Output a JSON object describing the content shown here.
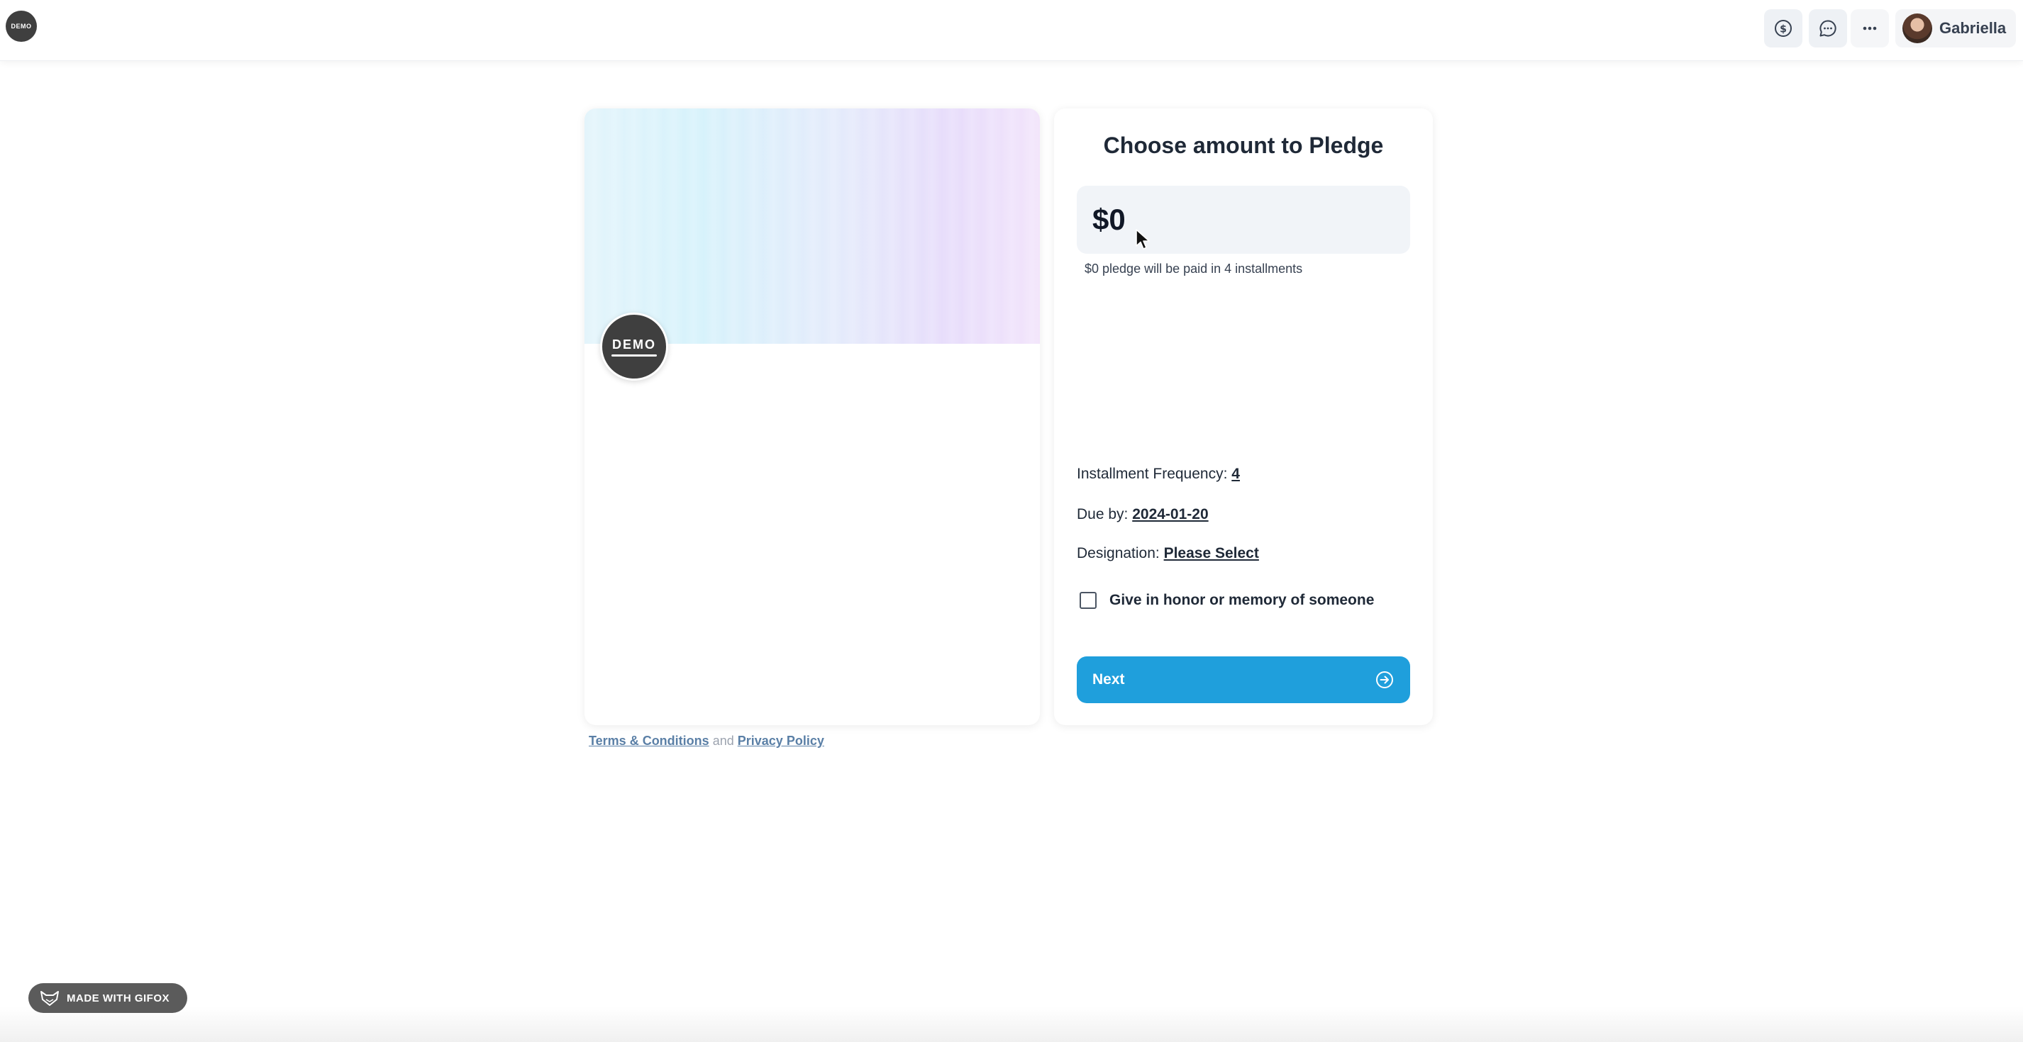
{
  "topbar": {
    "logo_text": "DEMO",
    "user_name": "Gabriella",
    "icons": [
      "dollar-icon",
      "chat-icon",
      "more-icon"
    ]
  },
  "campaign": {
    "logo_text": "DEMO"
  },
  "pledge": {
    "title": "Choose amount to Pledge",
    "amount": "$0",
    "note": "$0 pledge will be paid in 4 installments",
    "frequency_label": "Installment Frequency:",
    "frequency_value": "4",
    "due_label": "Due by:",
    "due_value": "2024-01-20",
    "designation_label": "Designation:",
    "designation_value": "Please Select",
    "honor_label": "Give in honor or memory of someone",
    "honor_checked": false,
    "next_label": "Next"
  },
  "legal": {
    "terms": "Terms & Conditions",
    "and": "and",
    "privacy": "Privacy Policy"
  },
  "badge": {
    "label": "MADE WITH GIFOX"
  },
  "colors": {
    "accent": "#1f9fdc",
    "link": "#5a7fa6",
    "logo_bg": "#3f3f3f"
  }
}
